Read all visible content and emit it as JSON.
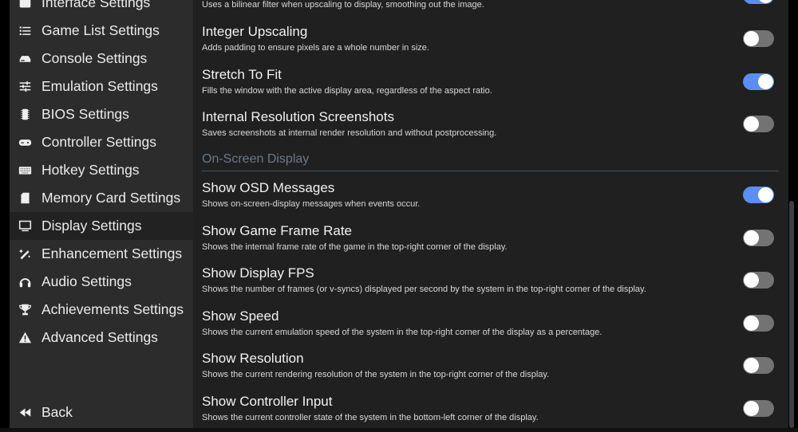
{
  "sidebar": {
    "items": [
      {
        "label": "Interface Settings",
        "icon": "window-icon"
      },
      {
        "label": "Game List Settings",
        "icon": "list-icon"
      },
      {
        "label": "Console Settings",
        "icon": "console-icon"
      },
      {
        "label": "Emulation Settings",
        "icon": "sliders-icon"
      },
      {
        "label": "BIOS Settings",
        "icon": "chip-icon"
      },
      {
        "label": "Controller Settings",
        "icon": "gamepad-icon"
      },
      {
        "label": "Hotkey Settings",
        "icon": "keyboard-icon"
      },
      {
        "label": "Memory Card Settings",
        "icon": "sd-card-icon"
      },
      {
        "label": "Display Settings",
        "icon": "monitor-icon",
        "selected": true
      },
      {
        "label": "Enhancement Settings",
        "icon": "magic-wand-icon"
      },
      {
        "label": "Audio Settings",
        "icon": "headphones-icon"
      },
      {
        "label": "Achievements Settings",
        "icon": "trophy-icon"
      },
      {
        "label": "Advanced Settings",
        "icon": "warning-icon"
      }
    ],
    "back": {
      "label": "Back",
      "icon": "backward-icon"
    }
  },
  "main": {
    "top_partial": {
      "description": "Uses a bilinear filter when upscaling to display, smoothing out the image.",
      "on": true
    },
    "settings_a": [
      {
        "title": "Integer Upscaling",
        "description": "Adds padding to ensure pixels are a whole number in size.",
        "on": false
      },
      {
        "title": "Stretch To Fit",
        "description": "Fills the window with the active display area, regardless of the aspect ratio.",
        "on": true
      },
      {
        "title": "Internal Resolution Screenshots",
        "description": "Saves screenshots at internal render resolution and without postprocessing.",
        "on": false
      }
    ],
    "section_header": "On-Screen Display",
    "settings_b": [
      {
        "title": "Show OSD Messages",
        "description": "Shows on-screen-display messages when events occur.",
        "on": true
      },
      {
        "title": "Show Game Frame Rate",
        "description": "Shows the internal frame rate of the game in the top-right corner of the display.",
        "on": false
      },
      {
        "title": "Show Display FPS",
        "description": "Shows the number of frames (or v-syncs) displayed per second by the system in the top-right corner of the display.",
        "on": false
      },
      {
        "title": "Show Speed",
        "description": "Shows the current emulation speed of the system in the top-right corner of the display as a percentage.",
        "on": false
      },
      {
        "title": "Show Resolution",
        "description": "Shows the current rendering resolution of the system in the top-right corner of the display.",
        "on": false
      },
      {
        "title": "Show Controller Input",
        "description": "Shows the current controller state of the system in the bottom-left corner of the display.",
        "on": false
      }
    ]
  },
  "colors": {
    "accent": "#5b8ef0",
    "sidebar_bg": "#2c2c2c",
    "main_bg": "#202020",
    "header": "#6c7886"
  }
}
